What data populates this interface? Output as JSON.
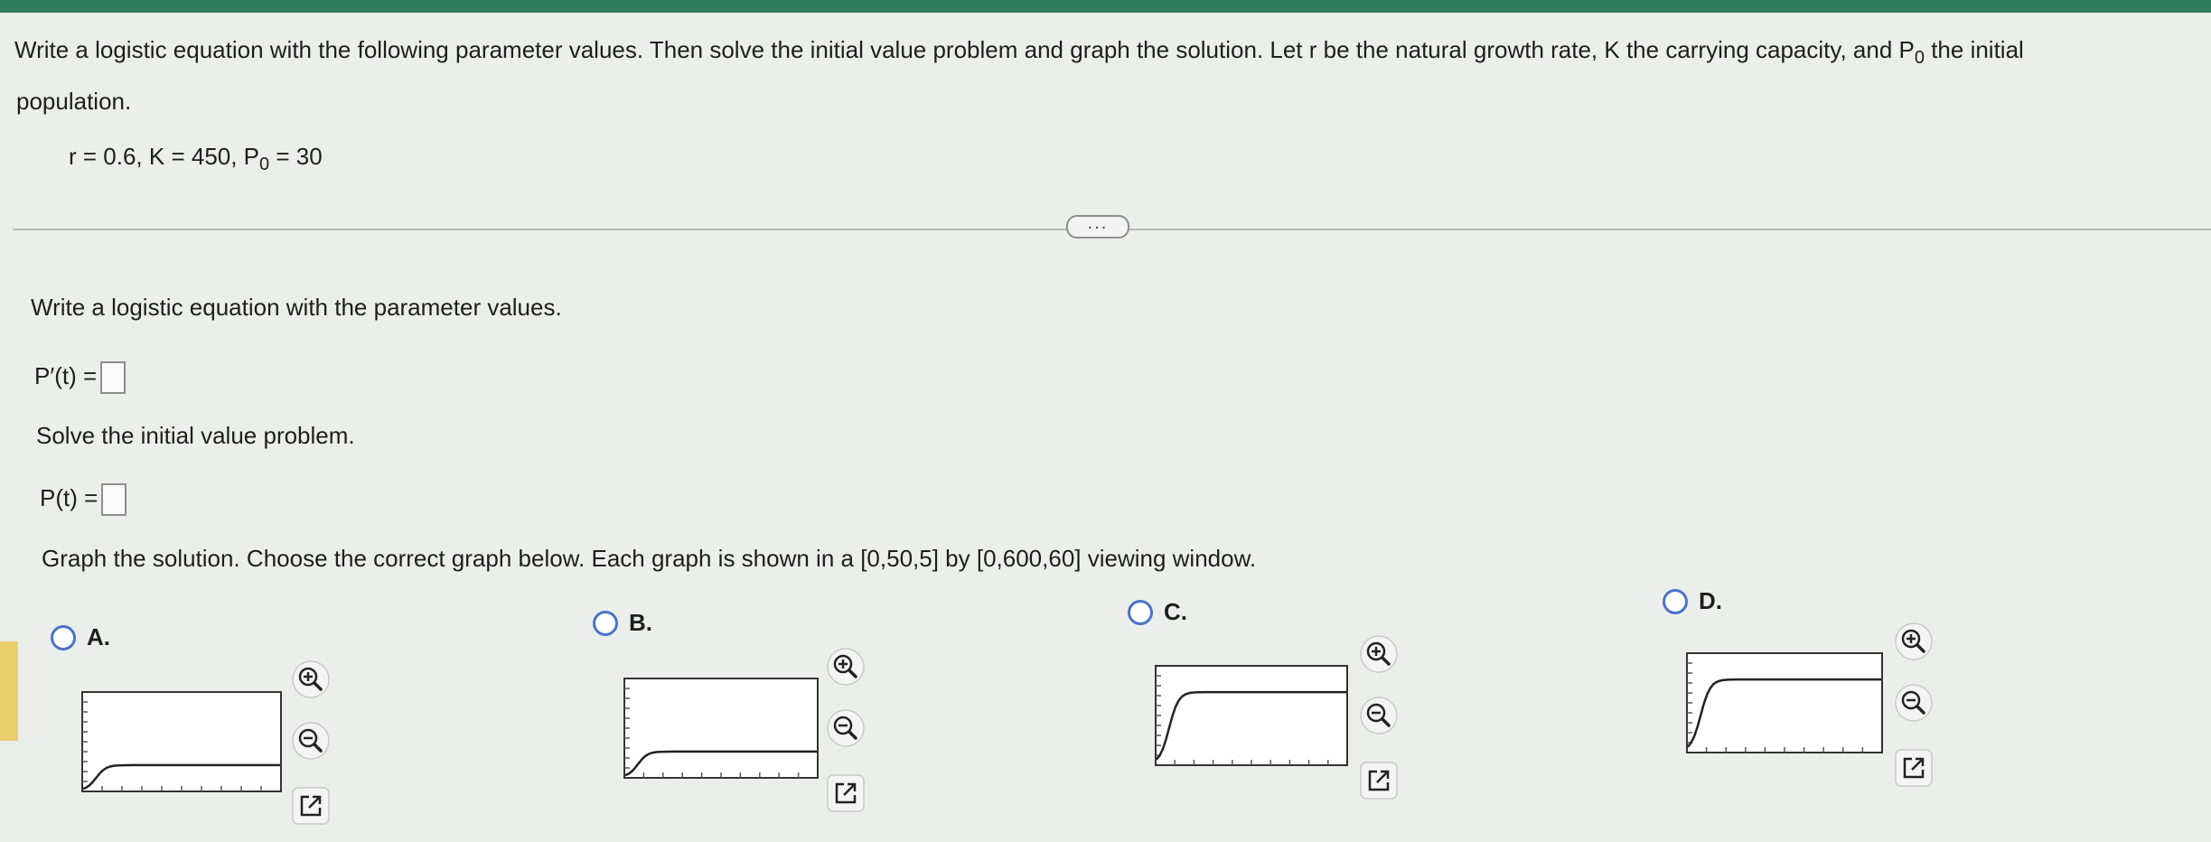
{
  "question": {
    "text": "Write a logistic equation with the following parameter values. Then solve the initial value problem and graph the solution. Let r be the natural growth rate, K the carrying capacity, and P",
    "text_sub": "0",
    "text_end": " the initial",
    "text_line2": "population.",
    "params_prefix": "r = 0.6, K = 450, P",
    "params_sub": "0",
    "params_suffix": " = 30"
  },
  "more_button": "...",
  "part1": {
    "prompt": "Write a logistic equation with the parameter values.",
    "label": "P′(t) ="
  },
  "part2": {
    "prompt": "Solve the initial value problem.",
    "label": "P(t) ="
  },
  "part3": {
    "prompt": "Graph the solution. Choose the correct graph below. Each graph is shown in a [0,50,5] by [0,600,60] viewing window."
  },
  "options": [
    {
      "label": "A.",
      "plateau": 0.26
    },
    {
      "label": "B.",
      "plateau": 0.26
    },
    {
      "label": "C.",
      "plateau": 0.74
    },
    {
      "label": "D.",
      "plateau": 0.74
    }
  ],
  "icons": [
    "zoom-in-icon",
    "zoom-out-icon",
    "open-external-icon"
  ]
}
